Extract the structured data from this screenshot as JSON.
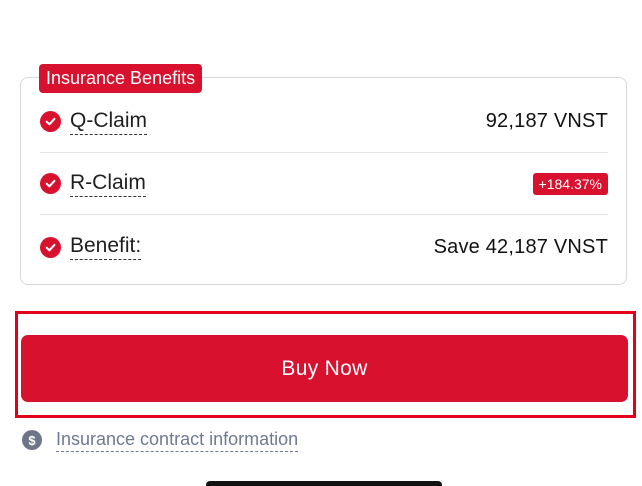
{
  "benefits_card": {
    "title": "Insurance Benefits",
    "rows": [
      {
        "label": "Q-Claim",
        "value": "92,187 VNST"
      },
      {
        "label": "R-Claim",
        "badge": "+184.37%"
      },
      {
        "label": "Benefit:",
        "value": "Save 42,187 VNST"
      }
    ]
  },
  "buy_button": {
    "label": "Buy Now"
  },
  "contract_info": {
    "label": "Insurance contract information"
  },
  "colors": {
    "accent": "#d8112f",
    "highlight_border": "#e4001b",
    "muted": "#6e7a92"
  },
  "icons": {
    "row_check": "check-circle-icon",
    "contract": "dollar-circle-icon"
  }
}
